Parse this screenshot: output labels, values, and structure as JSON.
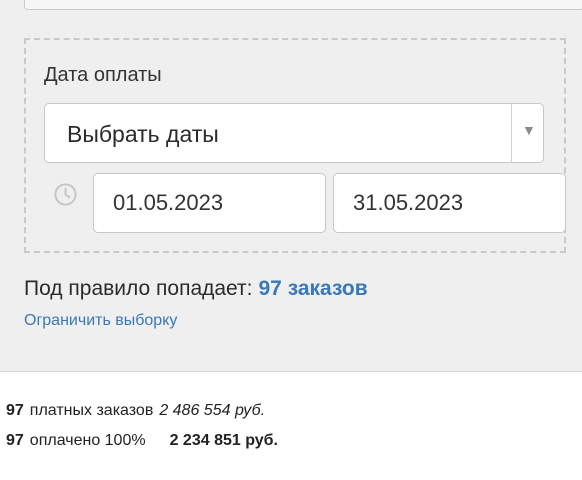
{
  "filter": {
    "label": "Дата оплаты",
    "select_value": "Выбрать даты",
    "select_arrow": "▼",
    "date_from": "01.05.2023",
    "date_to": "31.05.2023",
    "icon": "clock-icon"
  },
  "rule": {
    "text": "Под правило попадает:",
    "count": "97 заказов",
    "limit_link": "Ограничить выборку"
  },
  "stats": {
    "paid_count": "97",
    "paid_label": "платных заказов",
    "paid_sum": "2 486 554 руб.",
    "full_count": "97",
    "full_label": "оплачено 100%",
    "full_sum": "2 234 851 руб."
  },
  "colors": {
    "accent": "#3a78b6",
    "panel_bg": "#efefef"
  }
}
